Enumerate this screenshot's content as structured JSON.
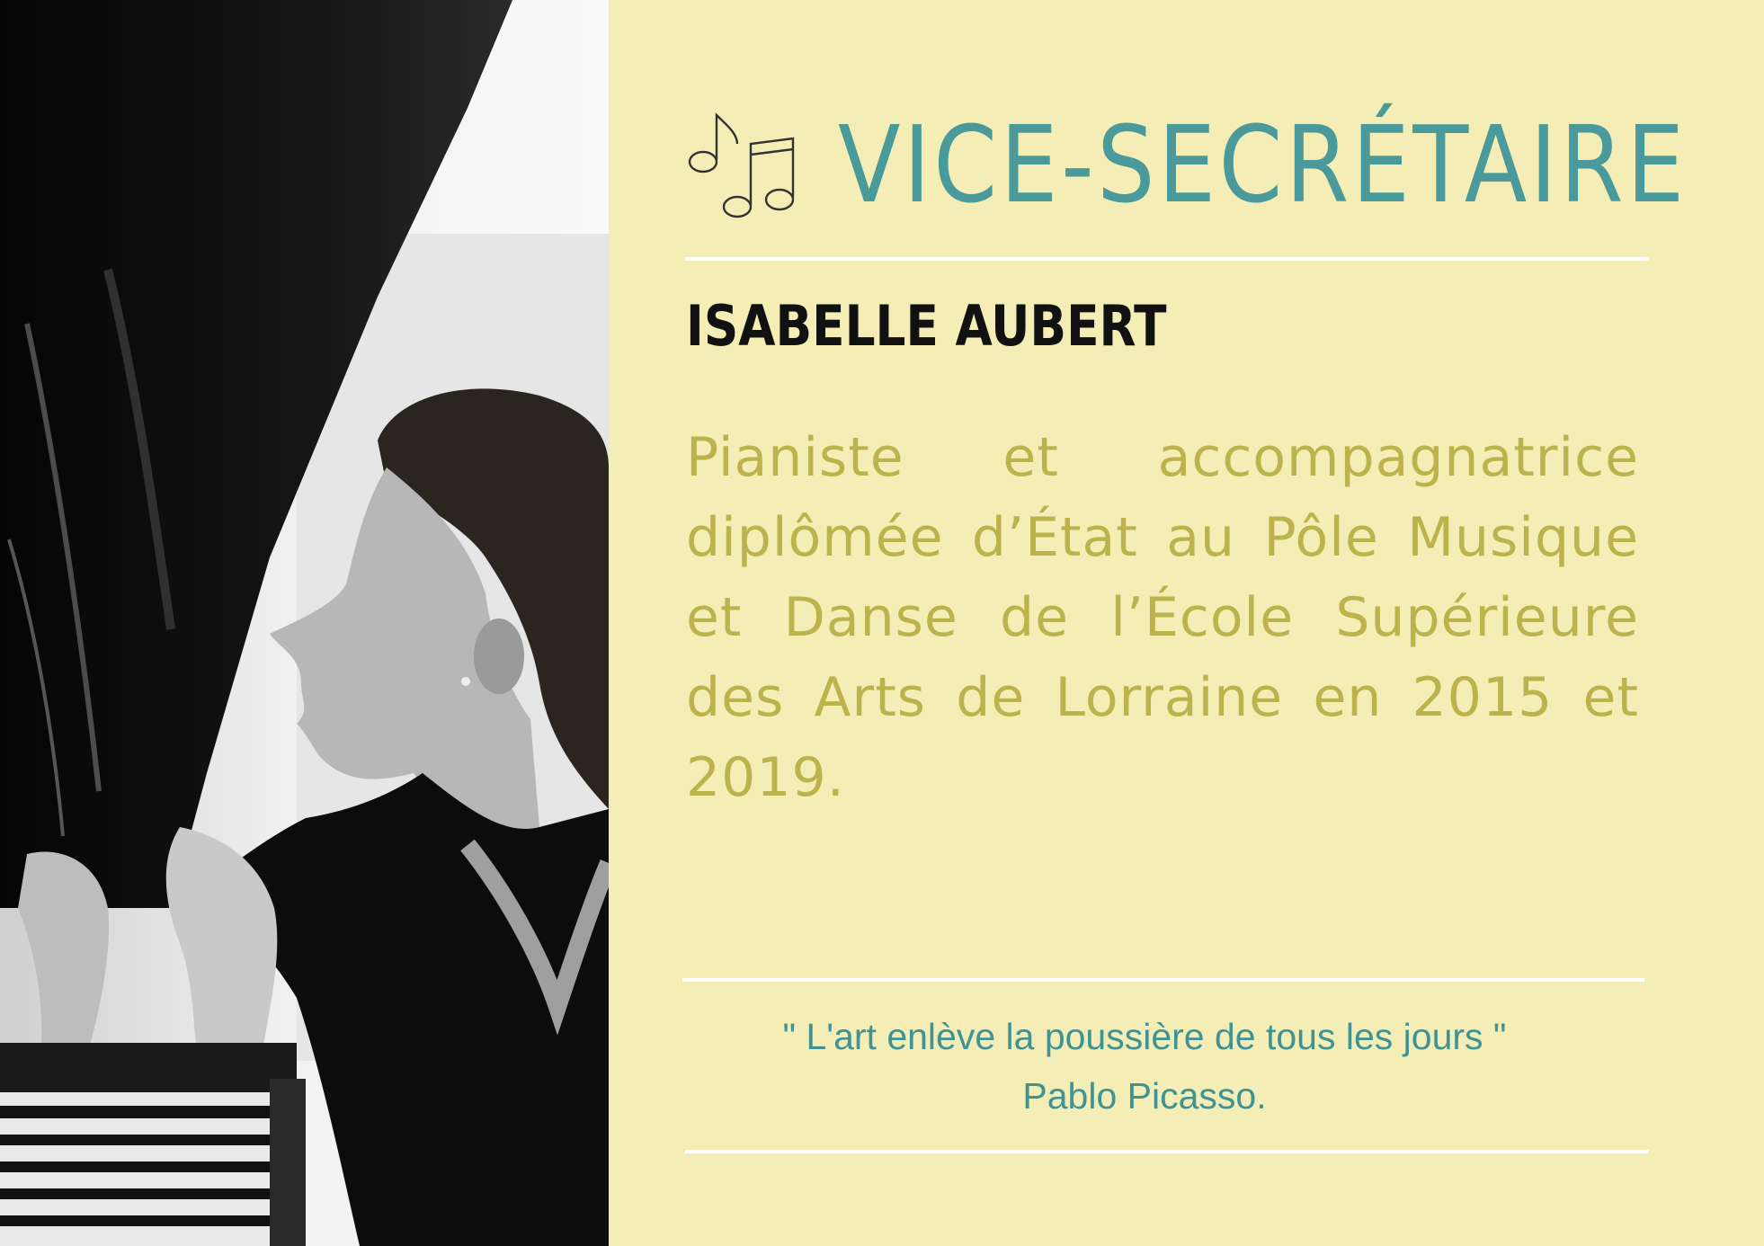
{
  "header": {
    "title": "VICE-SECRÉTAIRE",
    "icon": "music-notes-icon"
  },
  "person": {
    "name": "ISABELLE AUBERT",
    "bio": "Pianiste et accompagnatrice diplômée d’État au Pôle Musique et Danse de l’École Supérieure des Arts de Lorraine en 2015 et 2019.",
    "photo": "black-and-white photo of a woman leaning on a grand piano"
  },
  "quote": {
    "text": "\" L'art enlève la poussière de tous les jours \"",
    "author": "Pablo Picasso."
  },
  "colors": {
    "background": "#f4eeb6",
    "title": "#4a9a9b",
    "name": "#111111",
    "bio": "#bbb34c",
    "quote": "#3f9394",
    "rules": "#ffffff"
  }
}
